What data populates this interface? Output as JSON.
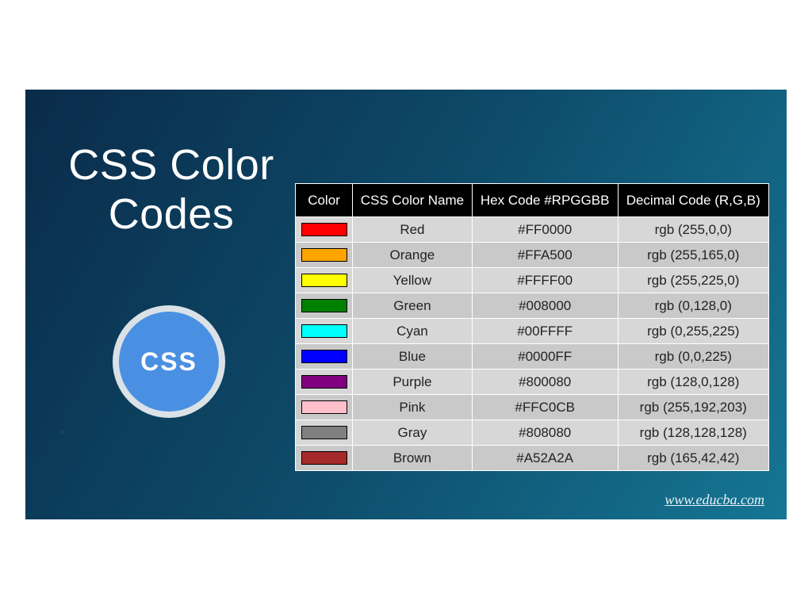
{
  "title": "CSS Color Codes",
  "badge": "CSS",
  "site": "www.educba.com",
  "table": {
    "headers": {
      "color": "Color",
      "name": "CSS Color Name",
      "hex": "Hex Code #RPGGBB",
      "dec": "Decimal Code (R,G,B)"
    },
    "rows": [
      {
        "swatch": "#FF0000",
        "name": "Red",
        "hex": "#FF0000",
        "dec": "rgb (255,0,0)"
      },
      {
        "swatch": "#FFA500",
        "name": "Orange",
        "hex": "#FFA500",
        "dec": "rgb (255,165,0)"
      },
      {
        "swatch": "#FFFF00",
        "name": "Yellow",
        "hex": "#FFFF00",
        "dec": "rgb (255,225,0)"
      },
      {
        "swatch": "#008000",
        "name": "Green",
        "hex": "#008000",
        "dec": "rgb (0,128,0)"
      },
      {
        "swatch": "#00FFFF",
        "name": "Cyan",
        "hex": "#00FFFF",
        "dec": "rgb (0,255,225)"
      },
      {
        "swatch": "#0000FF",
        "name": "Blue",
        "hex": "#0000FF",
        "dec": "rgb (0,0,225)"
      },
      {
        "swatch": "#800080",
        "name": "Purple",
        "hex": "#800080",
        "dec": "rgb (128,0,128)"
      },
      {
        "swatch": "#FFC0CB",
        "name": "Pink",
        "hex": "#FFC0CB",
        "dec": "rgb (255,192,203)"
      },
      {
        "swatch": "#808080",
        "name": "Gray",
        "hex": "#808080",
        "dec": "rgb (128,128,128)"
      },
      {
        "swatch": "#A52A2A",
        "name": "Brown",
        "hex": "#A52A2A",
        "dec": "rgb (165,42,42)"
      }
    ]
  }
}
